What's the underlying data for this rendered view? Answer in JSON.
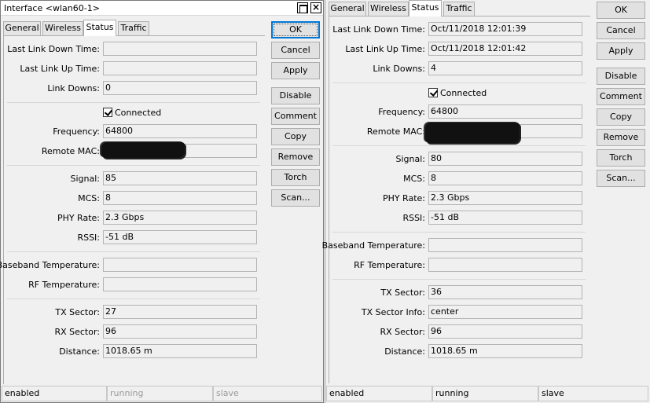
{
  "left_window": {
    "title": "Interface <wlan60-1>",
    "tabs": [
      "General",
      "Wireless",
      "Status",
      "Traffic"
    ],
    "active_tab": "Status",
    "fields": {
      "last_link_down_time": {
        "label": "Last Link Down Time:",
        "value": ""
      },
      "last_link_up_time": {
        "label": "Last Link Up Time:",
        "value": ""
      },
      "link_downs": {
        "label": "Link Downs:",
        "value": "0"
      },
      "connected": {
        "label": "Connected",
        "checked": true
      },
      "frequency": {
        "label": "Frequency:",
        "value": "64800"
      },
      "remote_mac": {
        "label": "Remote MAC:",
        "value": ""
      },
      "signal": {
        "label": "Signal:",
        "value": "85"
      },
      "mcs": {
        "label": "MCS:",
        "value": "8"
      },
      "phy_rate": {
        "label": "PHY Rate:",
        "value": "2.3 Gbps"
      },
      "rssi": {
        "label": "RSSI:",
        "value": "-51 dB"
      },
      "baseband_temperature": {
        "label": "Baseband Temperature:",
        "value": ""
      },
      "rf_temperature": {
        "label": "RF Temperature:",
        "value": ""
      },
      "tx_sector": {
        "label": "TX Sector:",
        "value": "27"
      },
      "rx_sector": {
        "label": "RX Sector:",
        "value": "96"
      },
      "distance": {
        "label": "Distance:",
        "value": "1018.65 m"
      }
    },
    "buttons": [
      "OK",
      "Cancel",
      "Apply",
      "Disable",
      "Comment",
      "Copy",
      "Remove",
      "Torch",
      "Scan..."
    ],
    "status_bar": [
      "enabled",
      "running",
      "slave"
    ]
  },
  "right_window": {
    "tabs": [
      "General",
      "Wireless",
      "Status",
      "Traffic"
    ],
    "active_tab": "Status",
    "fields": {
      "last_link_down_time": {
        "label": "Last Link Down Time:",
        "value": "Oct/11/2018 12:01:39"
      },
      "last_link_up_time": {
        "label": "Last Link Up Time:",
        "value": "Oct/11/2018 12:01:42"
      },
      "link_downs": {
        "label": "Link Downs:",
        "value": "4"
      },
      "connected": {
        "label": "Connected",
        "checked": true
      },
      "frequency": {
        "label": "Frequency:",
        "value": "64800"
      },
      "remote_mac": {
        "label": "Remote MAC:",
        "value": ""
      },
      "signal": {
        "label": "Signal:",
        "value": "80"
      },
      "mcs": {
        "label": "MCS:",
        "value": "8"
      },
      "phy_rate": {
        "label": "PHY Rate:",
        "value": "2.3 Gbps"
      },
      "rssi": {
        "label": "RSSI:",
        "value": "-51 dB"
      },
      "baseband_temperature": {
        "label": "Baseband Temperature:",
        "value": ""
      },
      "rf_temperature": {
        "label": "RF Temperature:",
        "value": ""
      },
      "tx_sector": {
        "label": "TX Sector:",
        "value": "36"
      },
      "tx_sector_info": {
        "label": "TX Sector Info:",
        "value": "center"
      },
      "rx_sector": {
        "label": "RX Sector:",
        "value": "96"
      },
      "distance": {
        "label": "Distance:",
        "value": "1018.65 m"
      }
    },
    "buttons": [
      "OK",
      "Cancel",
      "Apply",
      "Disable",
      "Comment",
      "Copy",
      "Remove",
      "Torch",
      "Scan..."
    ],
    "status_bar": [
      "enabled",
      "running",
      "slave"
    ]
  },
  "icons": {
    "maximize": "maximize-icon",
    "close": "close-icon"
  }
}
